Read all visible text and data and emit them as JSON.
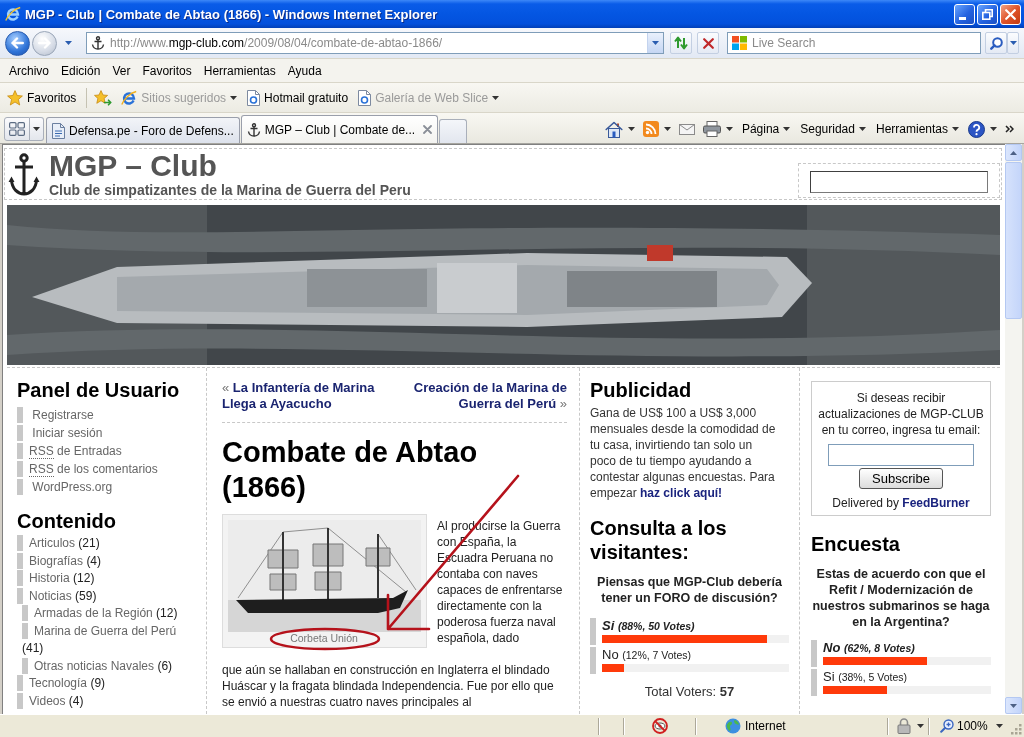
{
  "window": {
    "title": "MGP - Club | Combate de Abtao (1866) - Windows Internet Explorer"
  },
  "navigation": {
    "back_disabled": false,
    "forward_disabled": true
  },
  "address_bar": {
    "url_parts": [
      {
        "text": "http://www.",
        "highlighted": false
      },
      {
        "text": "mgp-club.com",
        "highlighted": true
      },
      {
        "text": "/2009/08/04/combate-de-abtao-1866/",
        "highlighted": false
      }
    ]
  },
  "search": {
    "placeholder": "Live Search"
  },
  "menu_bar": [
    "Archivo",
    "Edición",
    "Ver",
    "Favoritos",
    "Herramientas",
    "Ayuda"
  ],
  "favorites_bar": {
    "favorites_label": "Favoritos",
    "links": [
      {
        "label": "Sitios sugeridos",
        "dropdown": true,
        "disabled": true
      },
      {
        "label": "Hotmail gratuito",
        "dropdown": false,
        "disabled": false
      },
      {
        "label": "Galería de Web Slice",
        "dropdown": true,
        "disabled": true
      }
    ]
  },
  "tabs": [
    {
      "label": "Defensa.pe - Foro de Defens...",
      "selected": false
    },
    {
      "label": "MGP – Club | Combate de...",
      "selected": true
    }
  ],
  "command_bar": {
    "menus": [
      "Página",
      "Seguridad",
      "Herramientas"
    ]
  },
  "page": {
    "site": {
      "title": "MGP – Club",
      "tagline": "Club de simpatizantes de la Marina de Guerra del Peru"
    },
    "user_panel": {
      "title": "Panel de Usuario",
      "links": [
        {
          "label": "Registrarse"
        },
        {
          "label": "Iniciar sesión"
        },
        {
          "abbr": "RSS",
          "label": "de Entradas"
        },
        {
          "abbr": "RSS",
          "label": "de los comentarios"
        },
        {
          "label": "WordPress.org"
        }
      ]
    },
    "categories": {
      "title": "Contenido",
      "items": [
        {
          "label": "Articulos",
          "count": "(21)"
        },
        {
          "label": "Biografías",
          "count": "(4)"
        },
        {
          "label": "Historia",
          "count": "(12)"
        },
        {
          "label": "Noticias",
          "count": "(59)",
          "children": [
            {
              "label": "Armadas de la Región",
              "count": "(12)"
            },
            {
              "label": "Marina de Guerra del Perú",
              "count": "(41)"
            },
            {
              "label": "Otras noticias Navales",
              "count": "(6)"
            }
          ]
        },
        {
          "label": "Tecnología",
          "count": "(9)"
        },
        {
          "label": "Videos",
          "count": "(4)"
        }
      ]
    },
    "post_nav": {
      "previous": {
        "mark": "«",
        "title": "La Infantería de Marina Llega a Ayacucho"
      },
      "next": {
        "title": "Creación de la Marina de Guerra del Perú",
        "mark": "»"
      }
    },
    "post": {
      "title": "Combate de Abtao (1866)",
      "caption": "Corbeta Unión",
      "body": [
        "Al producirse la Guerra con España, la Escuadra Peruana no contaba con naves capaces de enfrentarse directamente con la poderosa fuerza naval española, dado",
        "que aún se hallaban en construcción en Inglaterra el blindado Huáscar y la fragata blindada Independencia. Fue por ello que se envió a nuestras cuatro naves principales al"
      ]
    },
    "ad": {
      "title": "Publicidad",
      "text": "Gana de US$ 100 a US$ 3,000 mensuales desde la comodidad de tu casa, invirtiendo tan solo un poco de tu tiempo ayudando a contestar algunas encuestas. Para empezar",
      "link": "haz click aquí!"
    },
    "visitor_poll": {
      "title": "Consulta a los visitantes:",
      "question": "Piensas que MGP-Club debería tener un FORO de discusión?",
      "answers": [
        {
          "label": "Si",
          "result": "(88%, 50 Votes)",
          "leading": true,
          "level": 0.88
        },
        {
          "label": "No",
          "result": "(12%, 7 Votes)",
          "leading": false,
          "level": 0.12
        }
      ],
      "total": "Total Voters: **57**"
    },
    "subscribe": {
      "text": "Si deseas recibir actualizaciones de MGP-CLUB en tu correo, ingresa tu email:",
      "button": "Subscribe",
      "credit": "Delivered by",
      "credit_link": "FeedBurner"
    },
    "survey": {
      "title": "Encuesta",
      "question": "Estas de acuerdo con que el Refit / Modernización de nuestros submarinos se haga en la Argentina?",
      "answers": [
        {
          "label": "No",
          "result": "(62%, 8 Votes)",
          "leading": true,
          "level": 0.62
        },
        {
          "label": "Si",
          "result": "(38%, 5 Votes)",
          "leading": false,
          "level": 0.38
        }
      ]
    }
  },
  "status_bar": {
    "zone": "Internet",
    "zoom": "100%"
  }
}
